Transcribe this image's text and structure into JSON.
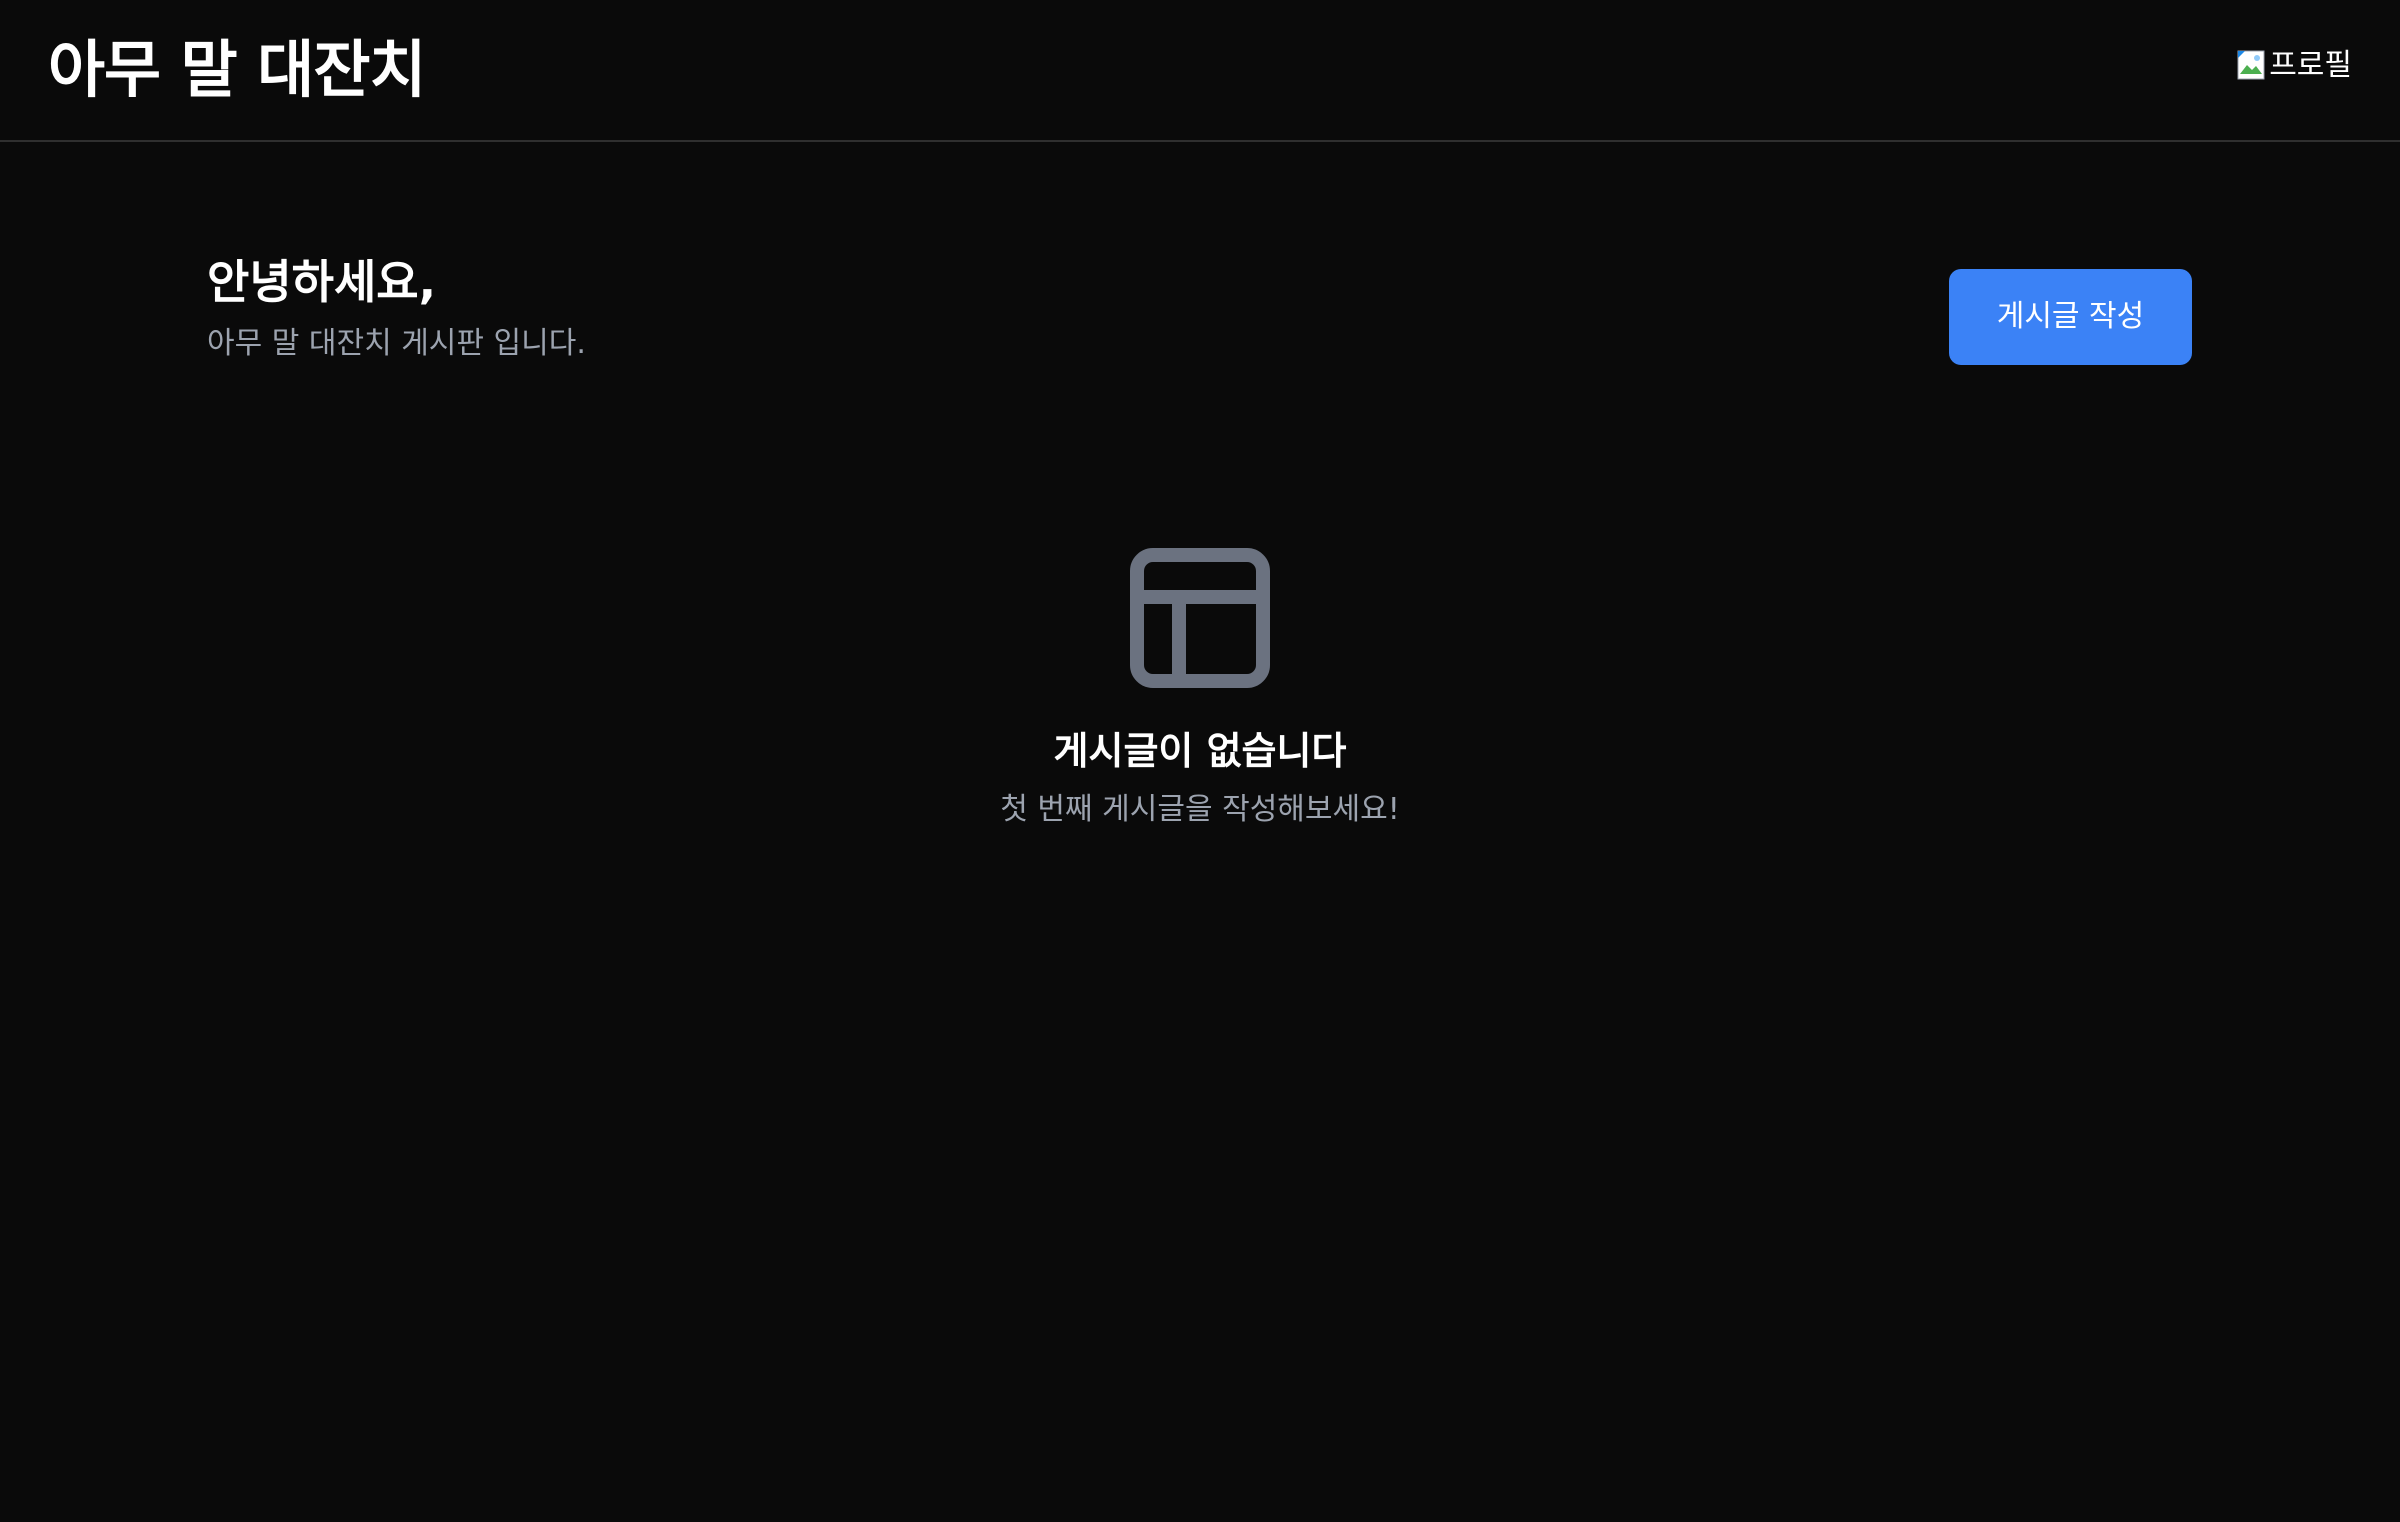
{
  "header": {
    "app_title": "아무 말 대잔치",
    "profile_alt": "프로필",
    "profile_icon": "broken-image-icon"
  },
  "greeting": {
    "title": "안녕하세요,",
    "subtitle": "아무 말 대잔치 게시판 입니다."
  },
  "actions": {
    "write_label": "게시글 작성"
  },
  "empty_state": {
    "icon": "layout-icon",
    "title": "게시글이 없습니다",
    "subtitle": "첫 번째 게시글을 작성해보세요!"
  },
  "colors": {
    "background": "#0a0a0a",
    "accent": "#3b82f6",
    "muted_text": "#9ca3af",
    "icon": "#6b7280",
    "divider": "#2f2f2f"
  }
}
